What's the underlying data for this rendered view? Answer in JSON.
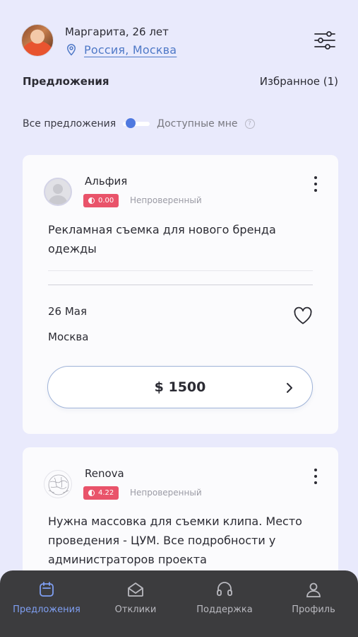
{
  "header": {
    "user_name": "Маргарита, 26 лет",
    "location": "Россия, Москва",
    "icons": {
      "location": "location-pin-icon",
      "filter": "filter-sliders-icon"
    }
  },
  "tabs": {
    "offers": "Предложения",
    "favorites": "Избранное (1)"
  },
  "toggle": {
    "left_label": "Все предложения",
    "right_label": "Доступные мне",
    "help": "?",
    "state": "all"
  },
  "cards": [
    {
      "author": "Альфия",
      "rating": "0.00",
      "status": "Непроверенный",
      "description": "Рекламная съемка для нового бренда одежды",
      "date": "26 Мая",
      "city": "Москва",
      "price": "$ 1500"
    },
    {
      "author": "Renova",
      "rating": "4.22",
      "status": "Непроверенный",
      "description": "Нужна массовка для съемки клипа. Место проведения - ЦУМ. Все подробности у администраторов проекта"
    }
  ],
  "tabbar": {
    "items": [
      {
        "label": "Предложения",
        "icon": "calendar-icon",
        "active": true
      },
      {
        "label": "Отклики",
        "icon": "envelope-icon",
        "active": false
      },
      {
        "label": "Поддержка",
        "icon": "headset-icon",
        "active": false
      },
      {
        "label": "Профиль",
        "icon": "user-icon",
        "active": false
      }
    ]
  },
  "colors": {
    "background": "#e9eafc",
    "accent": "#4f79c7",
    "active_tab": "#7f9ff2",
    "rating_badge": "#e9536a",
    "tabbar": "#3c3c3e"
  }
}
